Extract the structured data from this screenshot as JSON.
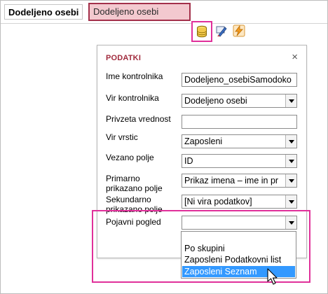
{
  "form": {
    "field_label": "Dodeljeno osebi",
    "field_control_value": "Dodeljeno osebi"
  },
  "toolbar": {
    "data_icon": "database-icon",
    "format_icon": "format-brush-icon",
    "event_icon": "lightning-icon"
  },
  "panel": {
    "title": "PODATKI",
    "close_glyph": "×",
    "properties": [
      {
        "label": "Ime kontrolnika",
        "value": "Dodeljeno_osebiSamodoko"
      },
      {
        "label": "Vir kontrolnika",
        "value": "Dodeljeno osebi"
      },
      {
        "label": "Privzeta vrednost",
        "value": ""
      },
      {
        "label": "Vir vrstic",
        "value": "Zaposleni"
      },
      {
        "label": "Vezano polje",
        "value": "ID"
      },
      {
        "label": "Primarno prikazano polje",
        "value": "Prikaz imena – ime in pr"
      },
      {
        "label": "Sekundarno prikazano polje",
        "value": "[Ni vira podatkov]"
      },
      {
        "label": "Pojavni pogled",
        "value": ""
      }
    ]
  },
  "dropdown": {
    "options": [
      "Po skupini",
      "Zaposleni Podatkovni list",
      "Zaposleni Seznam"
    ],
    "selected_index": 2
  },
  "colors": {
    "accent_pink": "#e0309a",
    "title_red": "#a12b3d",
    "selection_blue": "#3399ff"
  }
}
